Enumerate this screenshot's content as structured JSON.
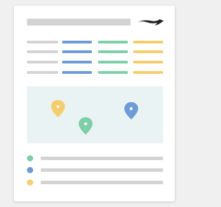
{
  "colors": {
    "background": "#f0f0f0",
    "card": "#ffffff",
    "placeholder_gray": "#d3d3d3",
    "blue": "#6b9bd8",
    "green": "#7ccfa7",
    "yellow": "#f7cc6a",
    "map_fill": "#e9f3f3",
    "logo": "#222222"
  },
  "header": {
    "logo_icon": "logo-icon"
  },
  "table": {
    "columns": [
      "gray",
      "blue",
      "green",
      "yellow"
    ],
    "row_count": 4
  },
  "map": {
    "pins": [
      {
        "color": "yellow",
        "icon": "map-pin-icon"
      },
      {
        "color": "green",
        "icon": "map-pin-icon"
      },
      {
        "color": "blue",
        "icon": "map-pin-icon"
      }
    ]
  },
  "legend": {
    "items": [
      {
        "color": "green"
      },
      {
        "color": "blue"
      },
      {
        "color": "yellow"
      }
    ]
  }
}
